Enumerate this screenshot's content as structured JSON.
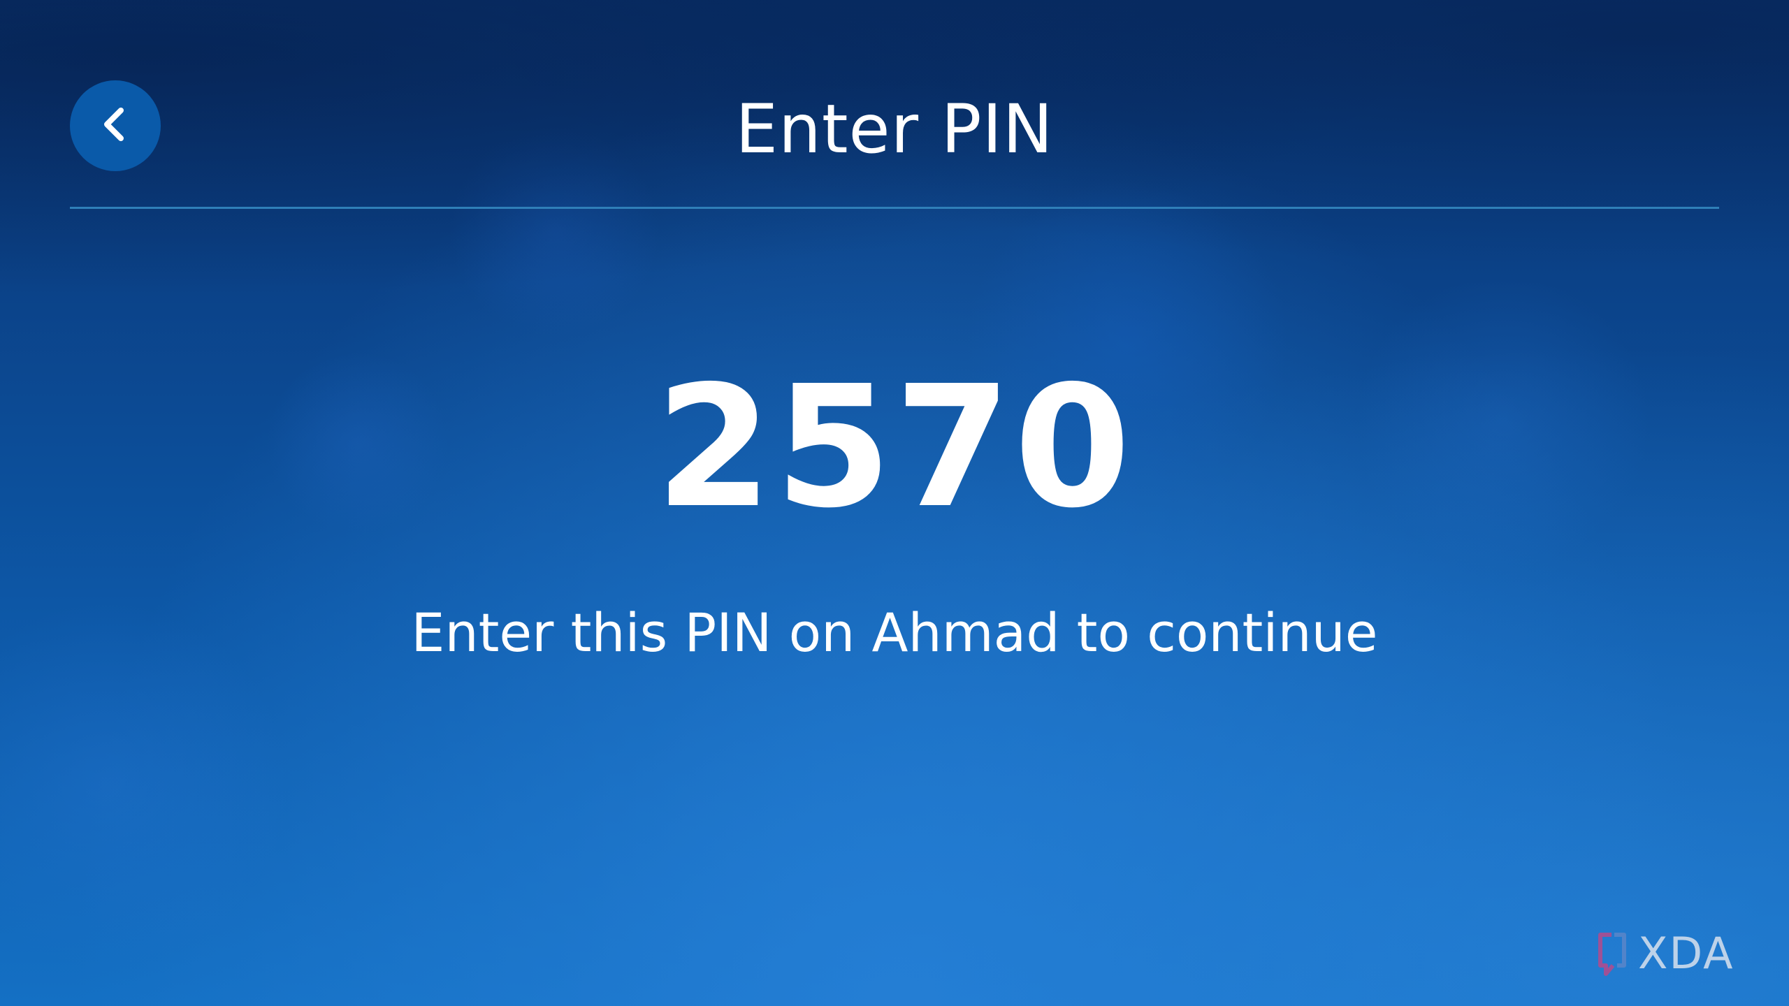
{
  "header": {
    "title": "Enter PIN",
    "back_icon": "chevron-left-icon"
  },
  "main": {
    "pin": "2570",
    "instruction": "Enter this PIN on Ahmad to continue"
  },
  "watermark": {
    "text": "XDA",
    "logo_icon": "xda-bracket-icon"
  },
  "colors": {
    "background_top": "#08326f",
    "background_bottom": "#1470c4",
    "back_button": "#0a5aa9",
    "divider": "#2f7fb8",
    "text": "#ffffff"
  }
}
